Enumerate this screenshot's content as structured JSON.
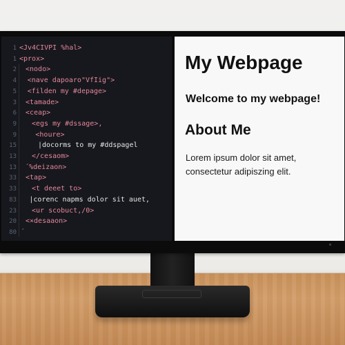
{
  "editor": {
    "lines": [
      {
        "num": "1",
        "text": "<Jv4CIVPI %hal>",
        "style": "c-tag",
        "indent": 0
      },
      {
        "num": "1",
        "text": "<prox>",
        "style": "c-tag",
        "indent": 0
      },
      {
        "num": "2",
        "text": "<nodo>",
        "style": "c-tag",
        "indent": 1
      },
      {
        "num": "4",
        "text": "<nave dapoaro\"VfIig\">",
        "style": "c-tag",
        "indent": 1.3
      },
      {
        "num": "5",
        "text": "<filden my #depage>",
        "style": "c-tag",
        "indent": 1.3
      },
      {
        "num": "3",
        "text": "<tamade>",
        "style": "c-tag",
        "indent": 1
      },
      {
        "num": "6",
        "text": "<ceap>",
        "style": "c-tag",
        "indent": 1
      },
      {
        "num": "9",
        "text": "<egs my #dssage>,",
        "style": "c-tag",
        "indent": 2
      },
      {
        "num": "9",
        "text": "<houre>",
        "style": "c-tag",
        "indent": 2.6
      },
      {
        "num": "15",
        "text": "|docorms to my #ddspagel",
        "style": "c-plain",
        "indent": 3
      },
      {
        "num": "13",
        "text": "</cesaom>",
        "style": "c-tag",
        "indent": 2
      },
      {
        "num": "13",
        "text": "´%deizaon>",
        "style": "c-tag",
        "indent": 0.9
      },
      {
        "num": "33",
        "text": "<tap>",
        "style": "c-tag",
        "indent": 1
      },
      {
        "num": "33",
        "text": "<t deeet to>",
        "style": "c-tag",
        "indent": 2
      },
      {
        "num": "83",
        "text": "|corenc napms dolor sit auet,",
        "style": "c-plain",
        "indent": 1.6
      },
      {
        "num": "23",
        "text": "<ur scobuct,/0>",
        "style": "c-tag",
        "indent": 2
      },
      {
        "num": "20",
        "text": "<×desaaon>",
        "style": "c-tag",
        "indent": 1
      },
      {
        "num": "80",
        "text": "´",
        "style": "c-gray",
        "indent": 0.2
      }
    ]
  },
  "webpage": {
    "title": "My Webpage",
    "welcome": "Welcome to my webpage!",
    "about_heading": "About Me",
    "lorem": "Lorem ipsum dolor sit amet, consectetur adipiszing elit."
  }
}
